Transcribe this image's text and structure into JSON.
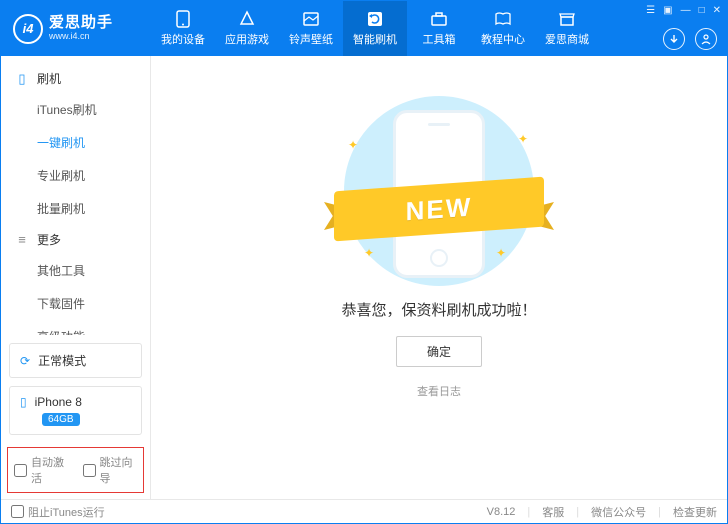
{
  "brand": {
    "name": "爱思助手",
    "logo_letters": "i4",
    "url": "www.i4.cn"
  },
  "topnav": [
    {
      "label": "我的设备"
    },
    {
      "label": "应用游戏"
    },
    {
      "label": "铃声壁纸"
    },
    {
      "label": "智能刷机",
      "active": true
    },
    {
      "label": "工具箱"
    },
    {
      "label": "教程中心"
    },
    {
      "label": "爱思商城"
    }
  ],
  "sidebar": {
    "group_flash": "刷机",
    "group_more": "更多",
    "items_flash": [
      {
        "label": "iTunes刷机"
      },
      {
        "label": "一键刷机",
        "active": true
      },
      {
        "label": "专业刷机"
      },
      {
        "label": "批量刷机"
      }
    ],
    "items_more": [
      {
        "label": "其他工具"
      },
      {
        "label": "下载固件"
      },
      {
        "label": "高级功能"
      }
    ],
    "mode": "正常模式",
    "device": {
      "name": "iPhone 8",
      "storage": "64GB"
    },
    "opts": {
      "auto_activate": "自动激活",
      "skip_guide": "跳过向导"
    }
  },
  "main": {
    "ribbon": "NEW",
    "message": "恭喜您，保资料刷机成功啦！",
    "ok": "确定",
    "view_log": "查看日志"
  },
  "footer": {
    "block_itunes": "阻止iTunes运行",
    "version": "V8.12",
    "support": "客服",
    "wechat": "微信公众号",
    "update": "检查更新"
  }
}
